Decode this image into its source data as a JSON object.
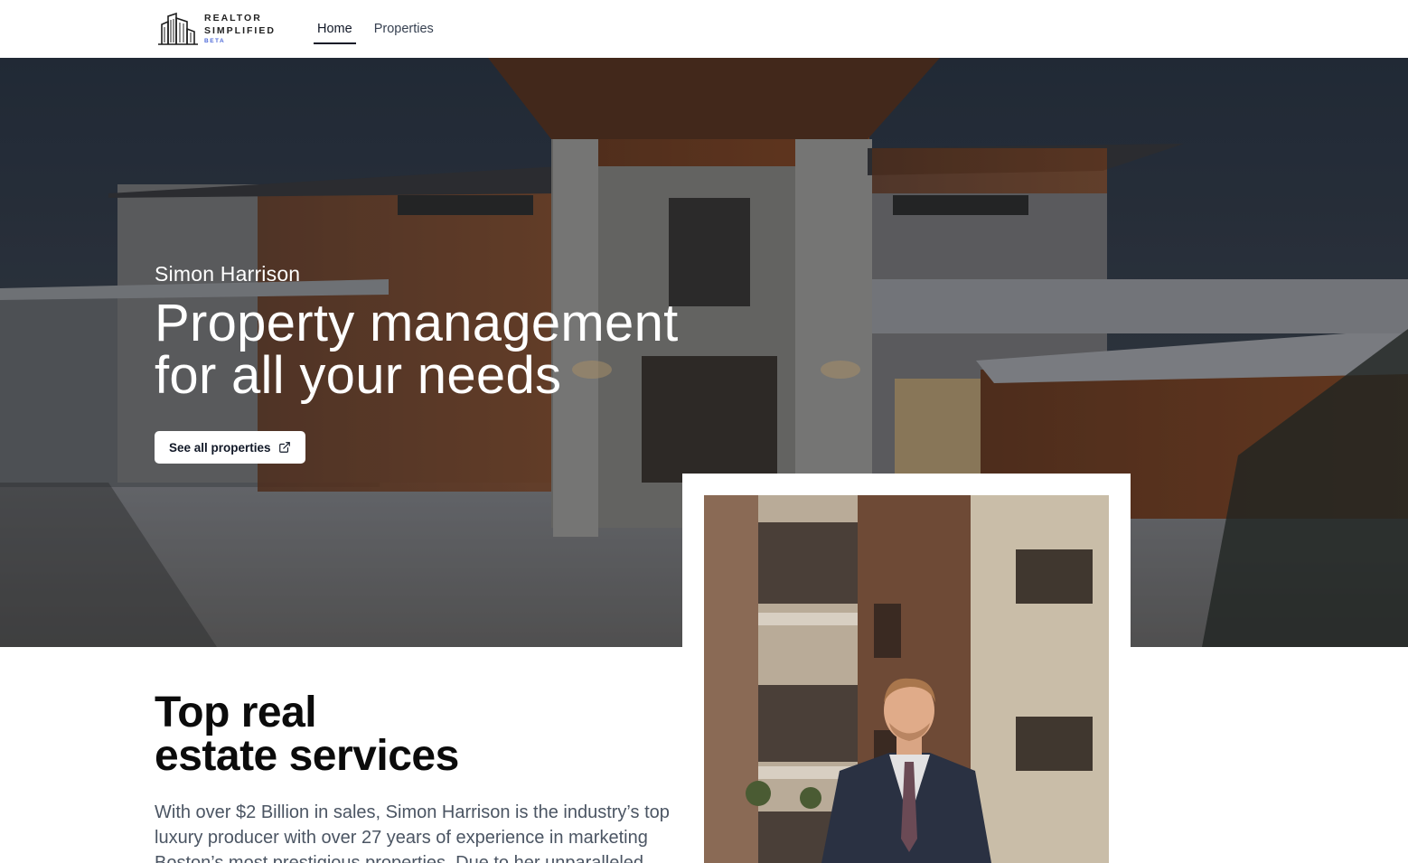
{
  "brand": {
    "line1": "REALTOR",
    "line2": "SIMPLIFIED",
    "badge": "BETA"
  },
  "nav": {
    "items": [
      {
        "label": "Home",
        "active": true
      },
      {
        "label": "Properties",
        "active": false
      }
    ]
  },
  "hero": {
    "name": "Simon Harrison",
    "title_line1": "Property management",
    "title_line2": "for all your needs",
    "cta_label": "See all properties",
    "cta_icon": "external-link-icon"
  },
  "services": {
    "title_line1": "Top real",
    "title_line2": "estate services",
    "body": "With over $2 Billion in sales, Simon Harrison is the industry’s top luxury producer with over 27 years of experience in marketing Boston’s most prestigious properties. Due to her unparalleled"
  },
  "colors": {
    "accent": "#4f6bd8",
    "text_dark": "#111827",
    "text_muted": "#4b5563"
  }
}
